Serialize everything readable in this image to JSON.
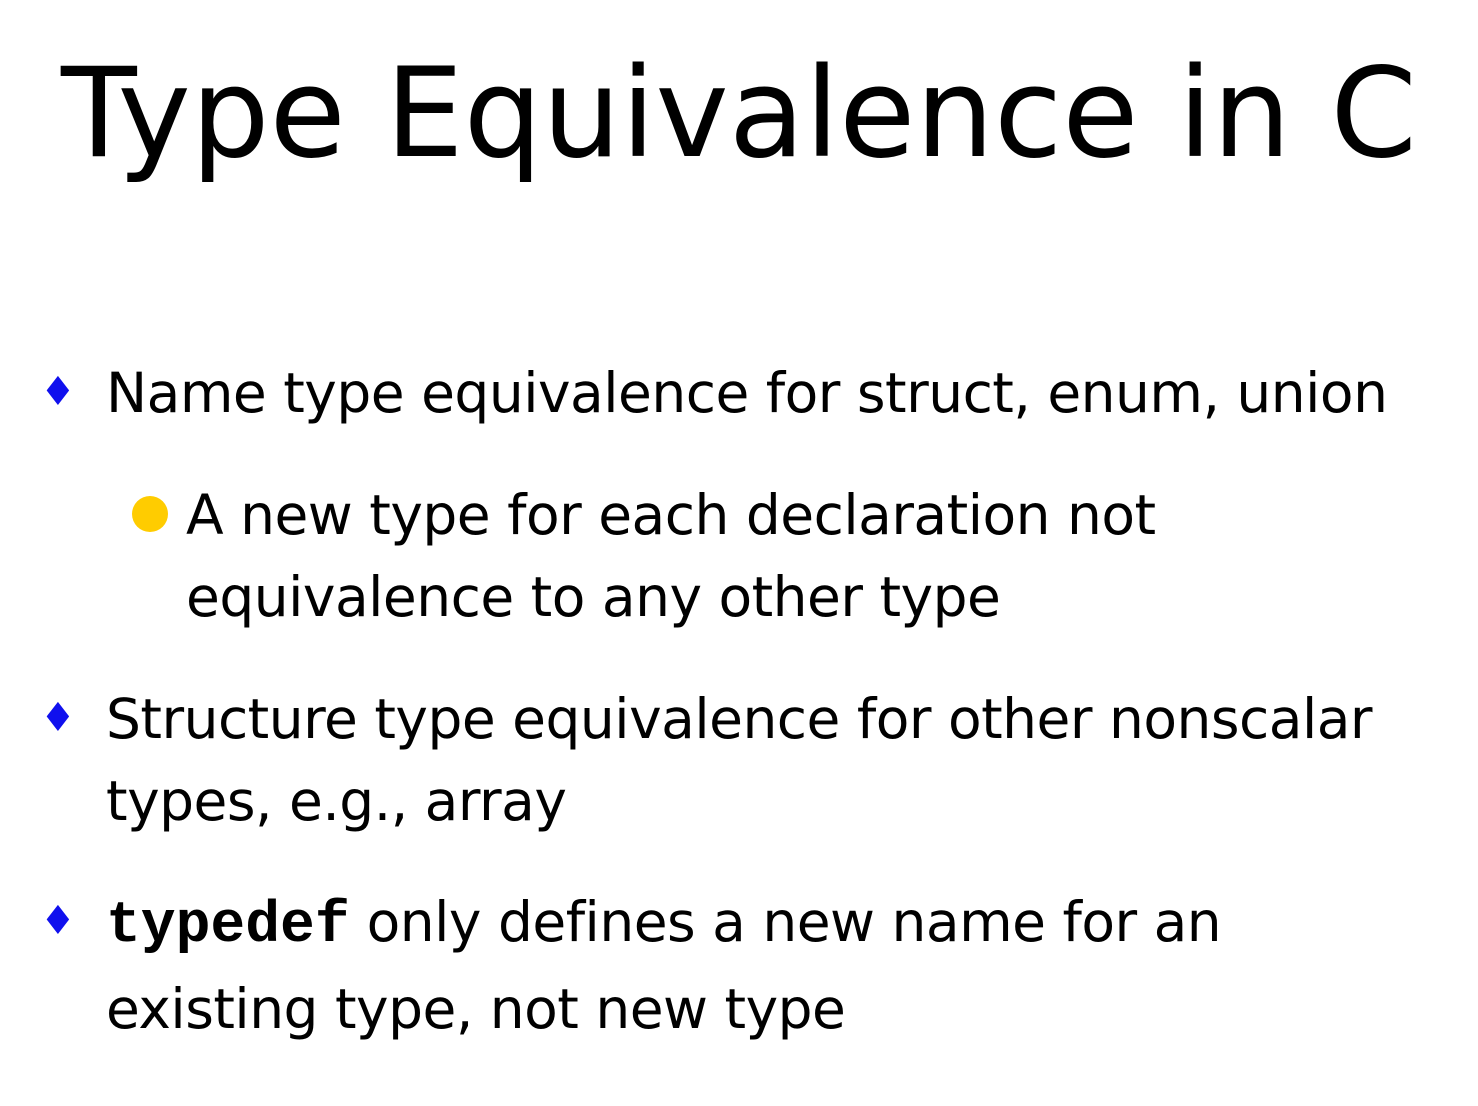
{
  "colors": {
    "diamond": "#1010ee",
    "dot": "#ffcc00",
    "text": "#000000"
  },
  "slide": {
    "title": "Type Equivalence in C",
    "bullets": [
      {
        "icon": "diamond-icon",
        "glyph": "♦",
        "text": "Name type equivalence for struct, enum, union",
        "sub": {
          "icon": "dot-icon",
          "text": "A new type for each declaration not equivalence to any other type"
        }
      },
      {
        "icon": "diamond-icon",
        "glyph": "♦",
        "text": "Structure type equivalence for other nonscalar types, e.g., array"
      },
      {
        "icon": "diamond-icon",
        "glyph": "♦",
        "code": "typedef",
        "text": " only defines a new name for an existing type, not new type"
      }
    ]
  }
}
